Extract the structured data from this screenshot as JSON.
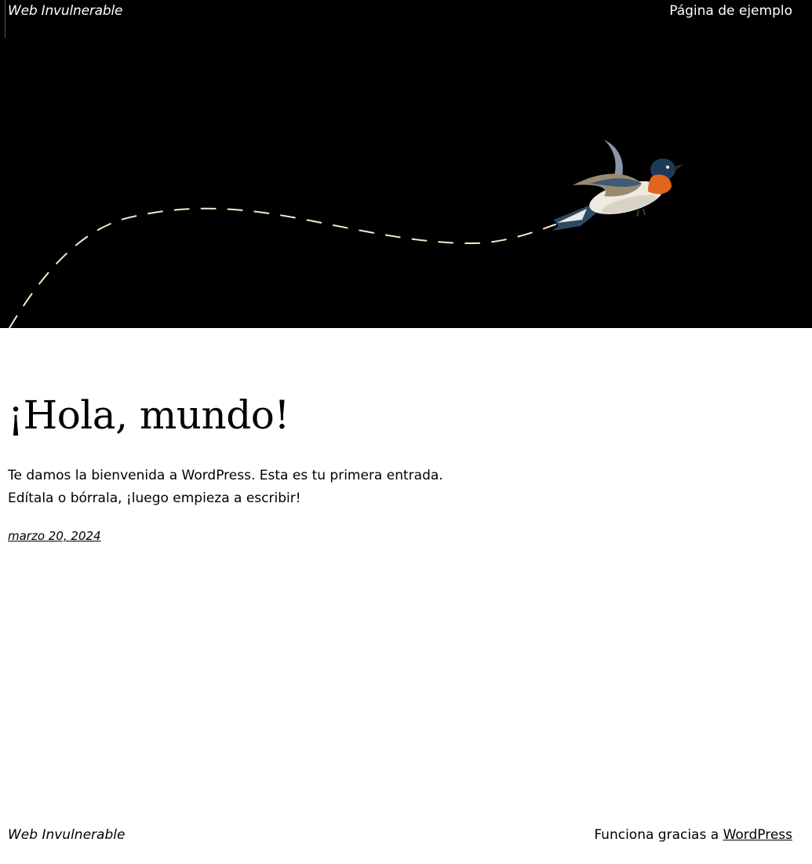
{
  "header": {
    "site_title": "Web Invulnerable",
    "nav_item": "Página de ejemplo"
  },
  "hero": {
    "image": "flying-bird-illustration",
    "background_color": "#000000",
    "path_color": "#f5e9c8"
  },
  "post": {
    "title": "¡Hola, mundo!",
    "excerpt": "Te damos la bienvenida a WordPress. Esta es tu primera entrada. Edítala o bórrala, ¡luego empieza a escribir!",
    "date": "marzo 20, 2024"
  },
  "footer": {
    "site_title": "Web Invulnerable",
    "credit_prefix": "Funciona gracias a ",
    "credit_link": "WordPress"
  }
}
